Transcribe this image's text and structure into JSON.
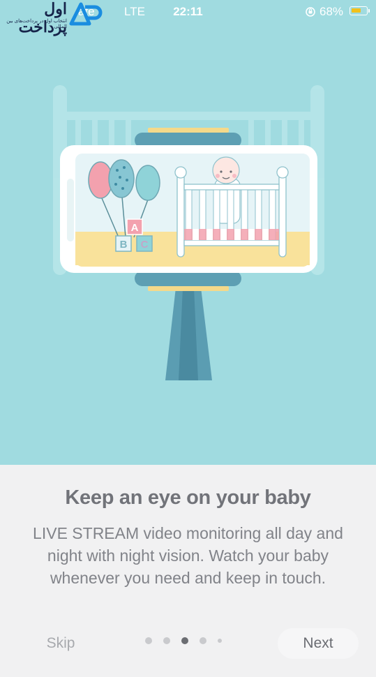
{
  "status_bar": {
    "carrier": "T...",
    "network_label": "ate",
    "network_type": "LTE",
    "time": "22:11",
    "battery_percent": "68%",
    "battery_level": 0.68,
    "icons": [
      "orientation-lock-icon",
      "battery-icon"
    ]
  },
  "watermark": {
    "title": "اول پرداخت",
    "tagline": "انتخاب اول در پرداخت‌های بین المللی"
  },
  "illustration": {
    "label": "baby-monitor-illustration",
    "blocks": [
      "A",
      "B",
      "C"
    ],
    "colors": {
      "background": "#a0dbe0",
      "mattress": "#f9e29b",
      "balloon_pink": "#f3a1ae",
      "balloon_blue": "#8fd3d8",
      "stand": "#5b9db2"
    }
  },
  "onboarding": {
    "title": "Keep an eye on your baby",
    "description": "LIVE STREAM video monitoring all day and night with night vision. Watch your baby whenever you need and keep in touch.",
    "skip_label": "Skip",
    "next_label": "Next",
    "page_count": 5,
    "current_page": 3
  }
}
